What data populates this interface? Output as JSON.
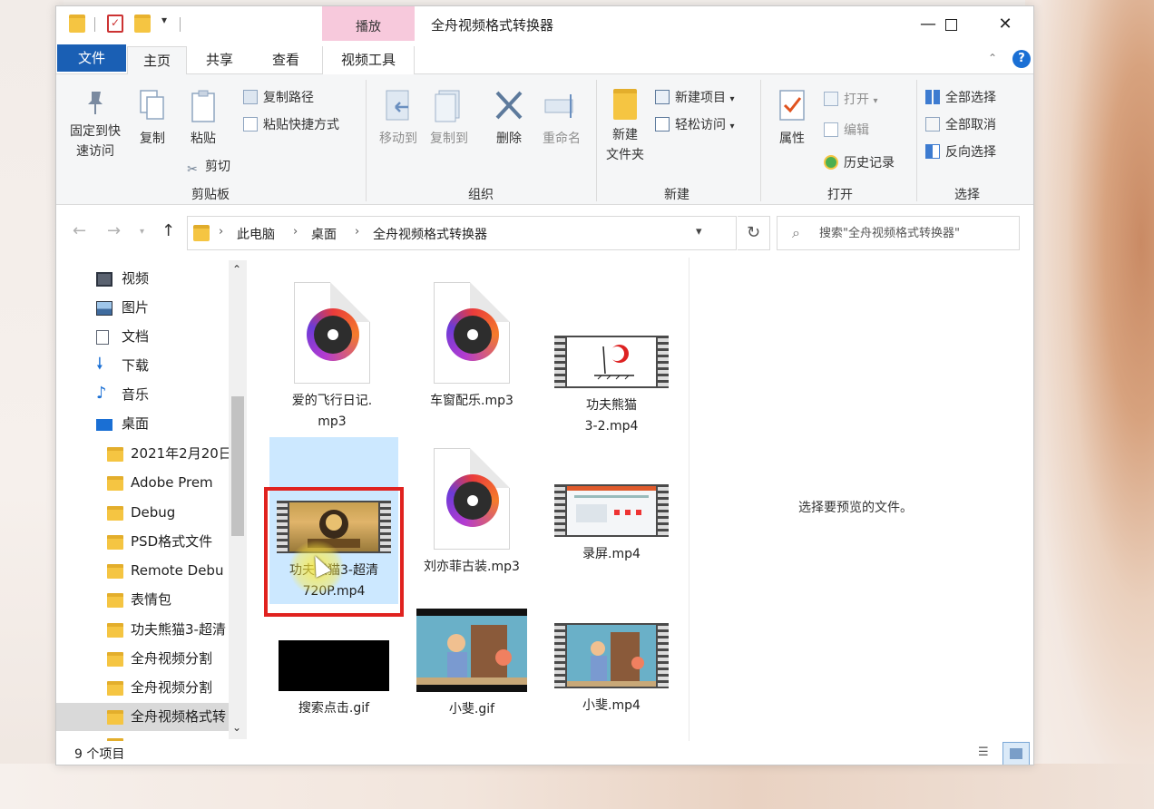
{
  "window": {
    "title": "全舟视频格式转换器",
    "contextual_tab_group": "播放"
  },
  "ribbon_tabs": {
    "file": "文件",
    "home": "主页",
    "share": "共享",
    "view": "查看",
    "video_tools": "视频工具"
  },
  "ribbon": {
    "clipboard": {
      "pin": "固定到快\n速访问",
      "copy": "复制",
      "paste": "粘贴",
      "copy_path": "复制路径",
      "paste_shortcut": "粘贴快捷方式",
      "cut": "剪切",
      "label": "剪贴板"
    },
    "organize": {
      "move_to": "移动到",
      "copy_to": "复制到",
      "delete": "删除",
      "rename": "重命名",
      "label": "组织"
    },
    "new": {
      "new_folder": "新建\n文件夹",
      "new_item": "新建项目",
      "easy_access": "轻松访问",
      "label": "新建"
    },
    "open": {
      "properties": "属性",
      "open": "打开",
      "edit": "编辑",
      "history": "历史记录",
      "label": "打开"
    },
    "select": {
      "select_all": "全部选择",
      "select_none": "全部取消",
      "invert": "反向选择",
      "label": "选择"
    }
  },
  "address": {
    "crumbs": [
      "此电脑",
      "桌面",
      "全舟视频格式转换器"
    ],
    "search_placeholder": "搜索\"全舟视频格式转换器\""
  },
  "sidebar": {
    "quick": [
      {
        "label": "视频",
        "icon": "video-library-icon"
      },
      {
        "label": "图片",
        "icon": "pictures-icon"
      },
      {
        "label": "文档",
        "icon": "documents-icon"
      },
      {
        "label": "下载",
        "icon": "download-arrow-icon"
      },
      {
        "label": "音乐",
        "icon": "music-note-icon"
      },
      {
        "label": "桌面",
        "icon": "desktop-icon"
      }
    ],
    "folders": [
      "2021年2月20日",
      "Adobe Prem",
      "Debug",
      "PSD格式文件",
      "Remote Debu",
      "表情包",
      "功夫熊猫3-超清",
      "全舟视频分割",
      "全舟视频分割",
      "全舟视频格式转"
    ]
  },
  "files": [
    {
      "name": "爱的飞行日记.\nmp3",
      "kind": "audio"
    },
    {
      "name": "车窗配乐.mp3",
      "kind": "audio"
    },
    {
      "name": "功夫熊猫\n3-2.mp4",
      "kind": "video"
    },
    {
      "name": "功夫熊猫3-超清\n720P.mp4",
      "kind": "video"
    },
    {
      "name": "刘亦菲古装.mp3",
      "kind": "audio"
    },
    {
      "name": "录屏.mp4",
      "kind": "video"
    },
    {
      "name": "搜索点击.gif",
      "kind": "gif"
    },
    {
      "name": "小斐.gif",
      "kind": "gif"
    },
    {
      "name": "小斐.mp4",
      "kind": "video"
    }
  ],
  "preview": {
    "message": "选择要预览的文件。"
  },
  "status": {
    "item_count": "9 个项目"
  },
  "colors": {
    "file_tab": "#1a5fb4",
    "contextual_tab": "#f7c9dc",
    "selection": "#cce8ff",
    "highlight_box": "#e0221f",
    "folder": "#f5c542"
  }
}
